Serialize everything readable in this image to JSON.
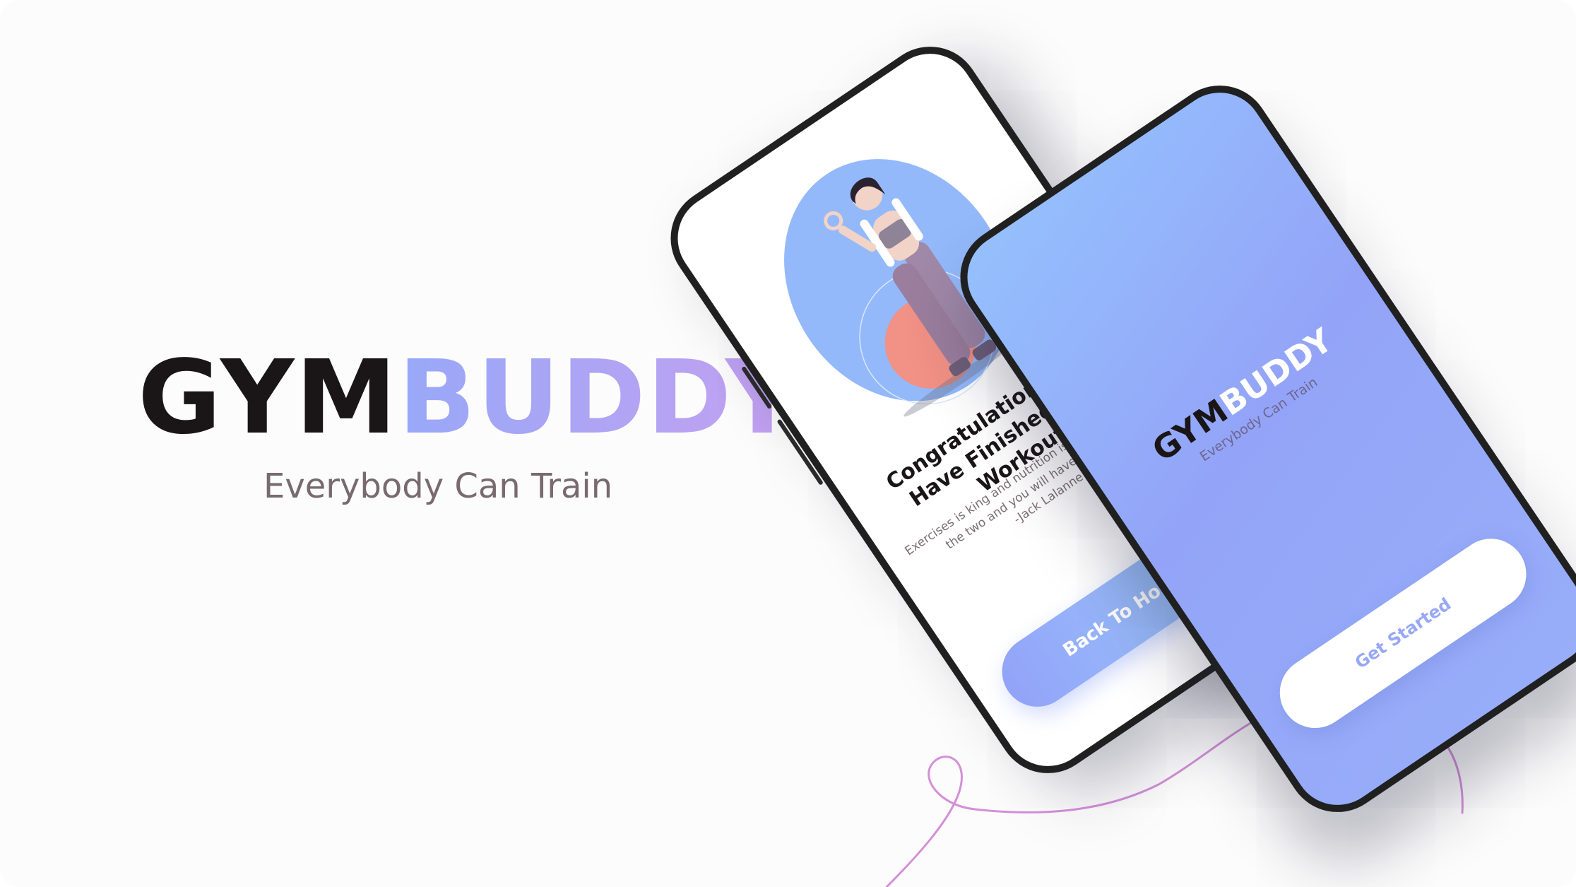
{
  "brand": {
    "logo_part1": "GYM",
    "logo_part2": "BUDDY",
    "tagline": "Everybody Can Train"
  },
  "phone_completion": {
    "title": "Congratulations, You Have Finished Your Workout",
    "quote": "Exercises is king and nutrition is queen. Combine the two and you will have a kingdom",
    "quote_author": "-Jack Lalanne",
    "button_label": "Back To Home"
  },
  "phone_welcome": {
    "logo_part1": "GYM",
    "logo_part2": "BUDDY",
    "tagline": "Everybody Can Train",
    "button_label": "Get Started"
  },
  "colors": {
    "accent_blue": "#92a3f8",
    "accent_light_blue": "#9dcefd",
    "accent_purple": "#c5a0f0",
    "text_dark": "#1a1516",
    "text_muted": "#786a6e",
    "curve": "#d48fd8"
  }
}
